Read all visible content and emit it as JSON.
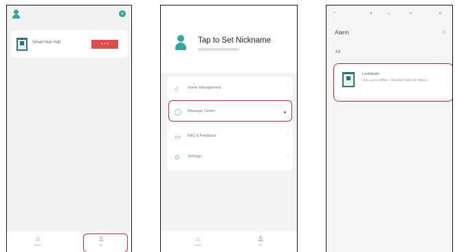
{
  "caption": "fig_tqfpqrqpqpqpqs",
  "colors": {
    "accent": "#2fa8a2",
    "highlight": "#e02020",
    "danger_button": "#e14b4b"
  },
  "screen1": {
    "device": {
      "name": "Smart Hub Hub",
      "action_label": "+ + +"
    },
    "tabs": [
      {
        "label": "Home",
        "icon": "home-icon"
      },
      {
        "label": "Me",
        "icon": "profile-icon"
      }
    ]
  },
  "screen2": {
    "profile": {
      "name": "Tap to Set Nickname"
    },
    "menu": [
      {
        "label": "Home Management",
        "icon": "home-icon"
      },
      {
        "label": "Message Center",
        "icon": "message-icon"
      },
      {
        "label": "FAQ & Feedback",
        "icon": "faq-icon"
      },
      {
        "label": "Settings",
        "icon": "settings-icon"
      }
    ],
    "tabs": [
      {
        "label": "Home",
        "icon": "home-icon"
      },
      {
        "label": "Me",
        "icon": "profile-icon"
      }
    ]
  },
  "screen3": {
    "status_icons": [
      "<",
      "▲",
      "▭",
      "✉",
      "⚙"
    ],
    "title": "Alarm",
    "filter_label": "All",
    "alarm": {
      "title": "Lockdown",
      "description": "Hub Lock is Offline - Unlocked Hub lock Device"
    }
  }
}
